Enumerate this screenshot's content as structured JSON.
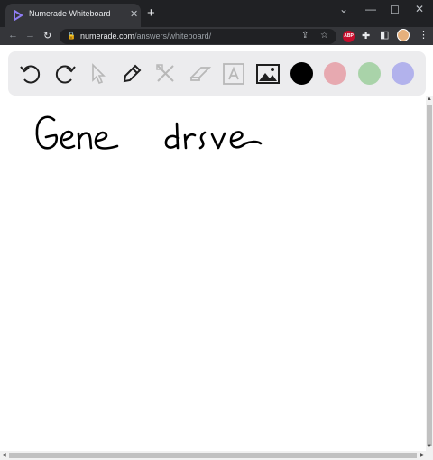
{
  "browser": {
    "tab_title": "Numerade Whiteboard",
    "url_host": "numerade.com",
    "url_path": "/answers/whiteboard/",
    "extension_badge": "ABP"
  },
  "icons": {
    "close": "close-icon",
    "new_tab": "plus-icon",
    "back": "back-arrow-icon",
    "forward": "forward-arrow-icon",
    "reload": "reload-icon",
    "lock": "lock-icon",
    "share": "share-icon",
    "star": "star-icon",
    "puzzle": "puzzle-icon",
    "sidepanel": "sidepanel-icon",
    "menu": "kebab-menu-icon"
  },
  "whiteboard": {
    "tools": [
      "undo",
      "redo",
      "select",
      "pen",
      "tools",
      "eraser",
      "text",
      "image"
    ],
    "colors": [
      "#000000",
      "#e7a9b0",
      "#a9d3a9",
      "#b2b2ec"
    ],
    "selected_color": "#000000"
  }
}
